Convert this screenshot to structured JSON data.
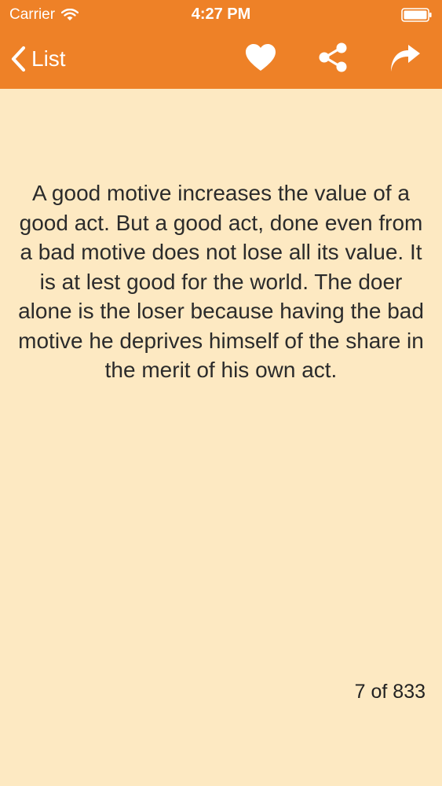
{
  "status_bar": {
    "carrier": "Carrier",
    "time": "4:27 PM",
    "wifi_icon": "wifi-icon",
    "battery_icon": "battery-full-icon"
  },
  "nav": {
    "back_label": "List",
    "back_icon": "chevron-left-icon",
    "actions": [
      "heart-icon",
      "share-icon",
      "forward-arrow-icon"
    ]
  },
  "quote": {
    "text": "A good motive increases the value of a good act. But a good act, done even from a bad motive does not lose all its value. It is at lest good for the world. The doer alone is the loser because having the bad motive he deprives himself of the share in the merit of his own act."
  },
  "pagination": {
    "label": "7 of 833"
  },
  "colors": {
    "accent": "#ee8127",
    "background": "#fde9c2",
    "text": "#2b2b2b",
    "bar_text": "#ffffff"
  }
}
